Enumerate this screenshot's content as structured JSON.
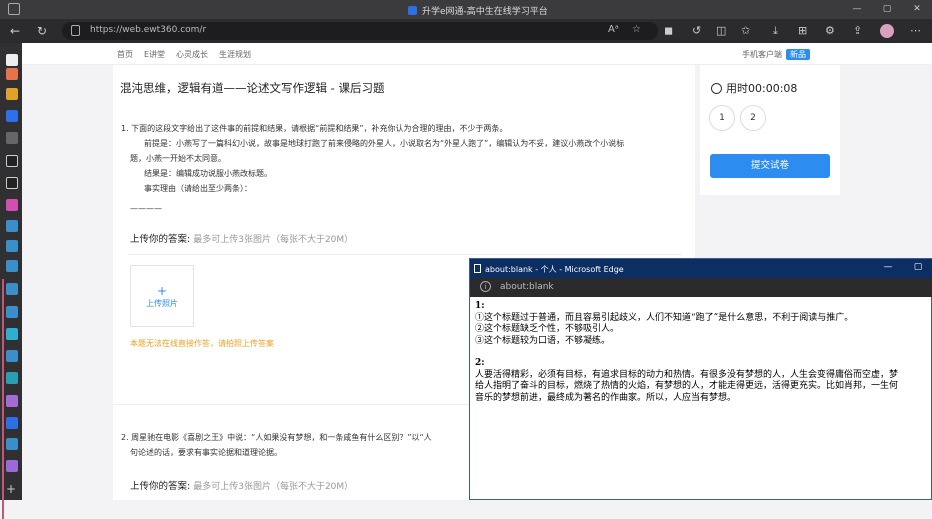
{
  "browser": {
    "window_title": "升学e网通-高中生在线学习平台",
    "url": "https://web.ewt360.com/r",
    "window_buttons": [
      "—",
      "▢",
      "✕"
    ]
  },
  "site_nav": {
    "items": [
      "首页",
      "E讲堂",
      "心灵成长",
      "生涯规划"
    ],
    "mobile_client": "手机客户端",
    "badge": "新品"
  },
  "page": {
    "title": "混沌思维，逻辑有道——论述文写作逻辑 - 课后习题",
    "q1": {
      "lines": [
        "1. 下面的这段文字给出了这件事的前提和结果，请根据“前提和结果”，补充你认为合理的理由，不少于两条。",
        "前提是：小燕写了一篇科幻小说，故事是地球打跑了前来侵略的外星人，小说取名为“外星人跑了”，编辑认为不妥，建议小燕改个小说标",
        "题，小燕一开始不太同意。",
        "结果是：编辑成功说服小燕改标题。",
        "事实理由（请给出至少两条）："
      ],
      "blank": "————",
      "answer_label": "上传你的答案:",
      "answer_hint": "最多可上传3张图片（每张不大于20M）",
      "upload_plus": "+",
      "upload_label": "上传照片",
      "warning": "本题无法在线直接作答，请拍照上传答案"
    },
    "q2": {
      "lines": [
        "2. 周星驰在电影《喜剧之王》中说：“人如果没有梦想，和一条咸鱼有什么区别？”以“人",
        "句论述的话，要求有事实论据和道理论据。"
      ],
      "answer_label": "上传你的答案:",
      "answer_hint": "最多可上传3张图片（每张不大于20M）"
    }
  },
  "side_panel": {
    "timer": "用时00:00:08",
    "questions": [
      "1",
      "2"
    ],
    "submit": "提交试卷"
  },
  "popup": {
    "title": "about:blank - 个人 - Microsoft Edge",
    "url": "about:blank",
    "buttons": [
      "—",
      "▢"
    ],
    "section1_head": "1:",
    "section1": [
      "①这个标题过于普通，而且容易引起歧义，人们不知道“跑了”是什么意思，不利于阅读与推广。",
      "②这个标题缺乏个性，不够吸引人。",
      "③这个标题较为口语，不够凝练。"
    ],
    "section2_head": "2:",
    "section2": [
      "人要活得精彩，必须有目标，有追求目标的动力和热情。有很多没有梦想的人，人生会变得庸俗而空虚，梦",
      "给人指明了奋斗的目标，燃烧了热情的火焰，有梦想的人，才能走得更远，活得更充实。比如肖邦，一生何",
      "音乐的梦想前进，最终成为著名的作曲家。所以，人应当有梦想。"
    ]
  },
  "colors": {
    "accent": "#2d8cf0",
    "warning": "#f0a020",
    "popup_titlebar": "#0c2e63"
  }
}
